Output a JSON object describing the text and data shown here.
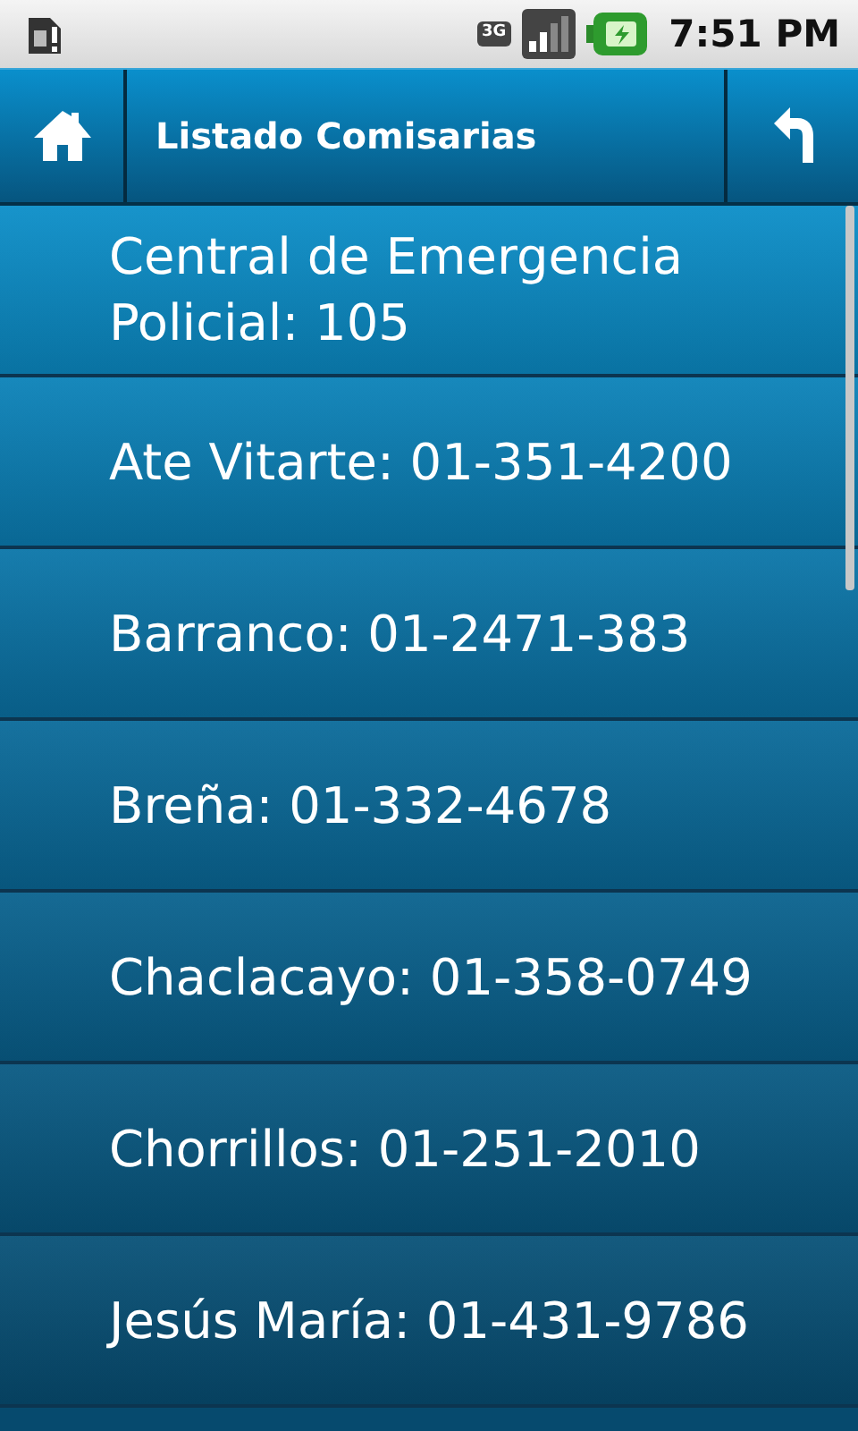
{
  "status_bar": {
    "time": "7:51 PM",
    "network": "3G"
  },
  "header": {
    "title": "Listado Comisarias"
  },
  "items": [
    {
      "label": "Central de Emergencia Policial: 105"
    },
    {
      "label": "Ate Vitarte: 01-351-4200"
    },
    {
      "label": "Barranco: 01-2471-383"
    },
    {
      "label": "Breña: 01-332-4678"
    },
    {
      "label": "Chaclacayo: 01-358-0749"
    },
    {
      "label": "Chorrillos: 01-251-2010"
    },
    {
      "label": "Jesús María: 01-431-9786"
    }
  ]
}
